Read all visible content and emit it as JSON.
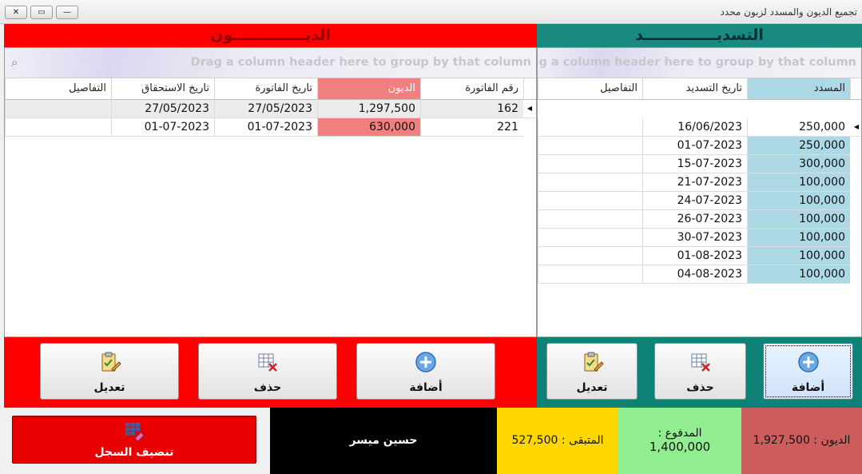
{
  "window": {
    "title": "تجميع الديون والمسدد لزبون محدد",
    "controls": [
      "✕",
      "▭",
      "—"
    ]
  },
  "debts": {
    "header": "الديــــــــــــــون",
    "group_hint": "Drag a column header here to group by that column",
    "columns": [
      "رقم الفاتورة",
      "الديون",
      "تاريخ الفاتورة",
      "تاريخ الاستحقاق",
      "التفاصيل"
    ],
    "rows": [
      {
        "invoice": "162",
        "amount": "1,297,500",
        "invoice_date": "27/05/2023",
        "due_date": "27/05/2023",
        "details": ""
      },
      {
        "invoice": "221",
        "amount": "630,000",
        "invoice_date": "01-07-2023",
        "due_date": "01-07-2023",
        "details": ""
      }
    ],
    "buttons": {
      "add": "أضافة",
      "delete": "حذف",
      "edit": "تعديل"
    }
  },
  "payments": {
    "header": "التسديــــــــــــــد",
    "group_hint": "Drag a column header here to group by that column",
    "columns": [
      "المسدد",
      "تاريخ التسديد",
      "التفاصيل"
    ],
    "rows": [
      {
        "paid": "250,000",
        "date": "16/06/2023",
        "details": ""
      },
      {
        "paid": "250,000",
        "date": "01-07-2023",
        "details": ""
      },
      {
        "paid": "300,000",
        "date": "15-07-2023",
        "details": ""
      },
      {
        "paid": "100,000",
        "date": "21-07-2023",
        "details": ""
      },
      {
        "paid": "100,000",
        "date": "24-07-2023",
        "details": ""
      },
      {
        "paid": "100,000",
        "date": "26-07-2023",
        "details": ""
      },
      {
        "paid": "100,000",
        "date": "30-07-2023",
        "details": ""
      },
      {
        "paid": "100,000",
        "date": "01-08-2023",
        "details": ""
      },
      {
        "paid": "100,000",
        "date": "04-08-2023",
        "details": ""
      }
    ],
    "buttons": {
      "add": "أضافة",
      "delete": "حذف",
      "edit": "تعديل"
    }
  },
  "summary": {
    "debts_label": "الديون : 1,927,500",
    "paid_label": "المدفوع :",
    "paid_value": "1,400,000",
    "remaining_label": "المتبقى : 527,500",
    "customer_name": "حسين ميسر",
    "clear_button": "تنضيف السجل"
  },
  "colors": {
    "debt_red": "#ff0000",
    "payment_teal": "#1a8a80",
    "debt_col_highlight": "#f08080",
    "paid_col_highlight": "#add8e6",
    "summary_debts_bg": "#cd5c5c",
    "summary_paid_bg": "#90ee90",
    "summary_remaining_bg": "#ffd700",
    "customer_bg": "#000000"
  }
}
